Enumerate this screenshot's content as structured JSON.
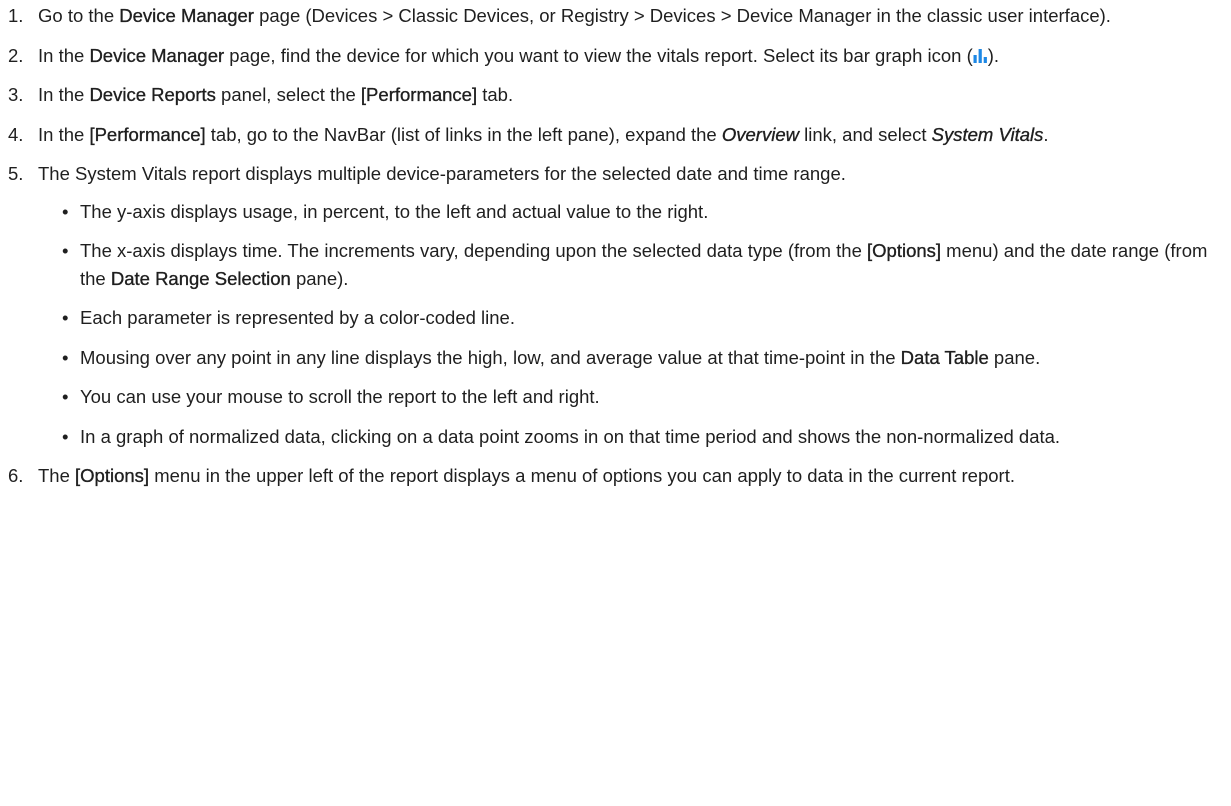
{
  "steps": [
    {
      "num": "1.",
      "parts": [
        {
          "t": "Go to the "
        },
        {
          "t": "Device Manager",
          "b": true
        },
        {
          "t": " page (Devices > Classic Devices, or Registry > Devices > Device Manager in the classic user interface)."
        }
      ]
    },
    {
      "num": "2.",
      "parts": [
        {
          "t": "In the "
        },
        {
          "t": "Device Manager",
          "b": true
        },
        {
          "t": " page, find the device for which you want to view the vitals report. Select its bar graph icon ("
        },
        {
          "icon": "bar-graph-icon"
        },
        {
          "t": ")."
        }
      ]
    },
    {
      "num": "3.",
      "parts": [
        {
          "t": "In the "
        },
        {
          "t": "Device Reports",
          "b": true
        },
        {
          "t": " panel, select the "
        },
        {
          "t": "[Performance]",
          "b": true
        },
        {
          "t": " tab."
        }
      ]
    },
    {
      "num": "4.",
      "parts": [
        {
          "t": "In the "
        },
        {
          "t": "[Performance]",
          "b": true
        },
        {
          "t": " tab, go to the NavBar (list of links in the left pane), expand the "
        },
        {
          "t": "Overview",
          "i": true
        },
        {
          "t": " link, and select "
        },
        {
          "t": "System Vitals",
          "i": true
        },
        {
          "t": "."
        }
      ]
    },
    {
      "num": "5.",
      "parts": [
        {
          "t": "The System Vitals report displays multiple device-parameters for the selected date and time range."
        }
      ],
      "bullets": [
        [
          {
            "t": "The y-axis displays usage, in percent, to the left and actual value to the right."
          }
        ],
        [
          {
            "t": "The x-axis displays time. The increments vary, depending upon the selected data type (from the "
          },
          {
            "t": "[Options]",
            "b": true
          },
          {
            "t": " menu) and the date range (from the "
          },
          {
            "t": "Date Range Selection",
            "b": true
          },
          {
            "t": " pane)."
          }
        ],
        [
          {
            "t": "Each parameter is represented by a color-coded line."
          }
        ],
        [
          {
            "t": "Mousing over any point in any line displays the high, low, and average value at that time-point in the "
          },
          {
            "t": "Data Table",
            "b": true
          },
          {
            "t": " pane."
          }
        ],
        [
          {
            "t": "You can use your mouse to scroll the report to the left and right."
          }
        ],
        [
          {
            "t": "In a graph of normalized data, clicking on a data point zooms in on that time period and shows the non-normalized data."
          }
        ]
      ]
    },
    {
      "num": "6.",
      "parts": [
        {
          "t": "The "
        },
        {
          "t": "[Options]",
          "b": true
        },
        {
          "t": " menu in the upper left of the report displays a menu of options you can apply to data in the current report."
        }
      ]
    }
  ],
  "bullet_glyph": "•",
  "colors": {
    "text": "#1f1f1f",
    "icon_blue": "#1e88e5"
  }
}
